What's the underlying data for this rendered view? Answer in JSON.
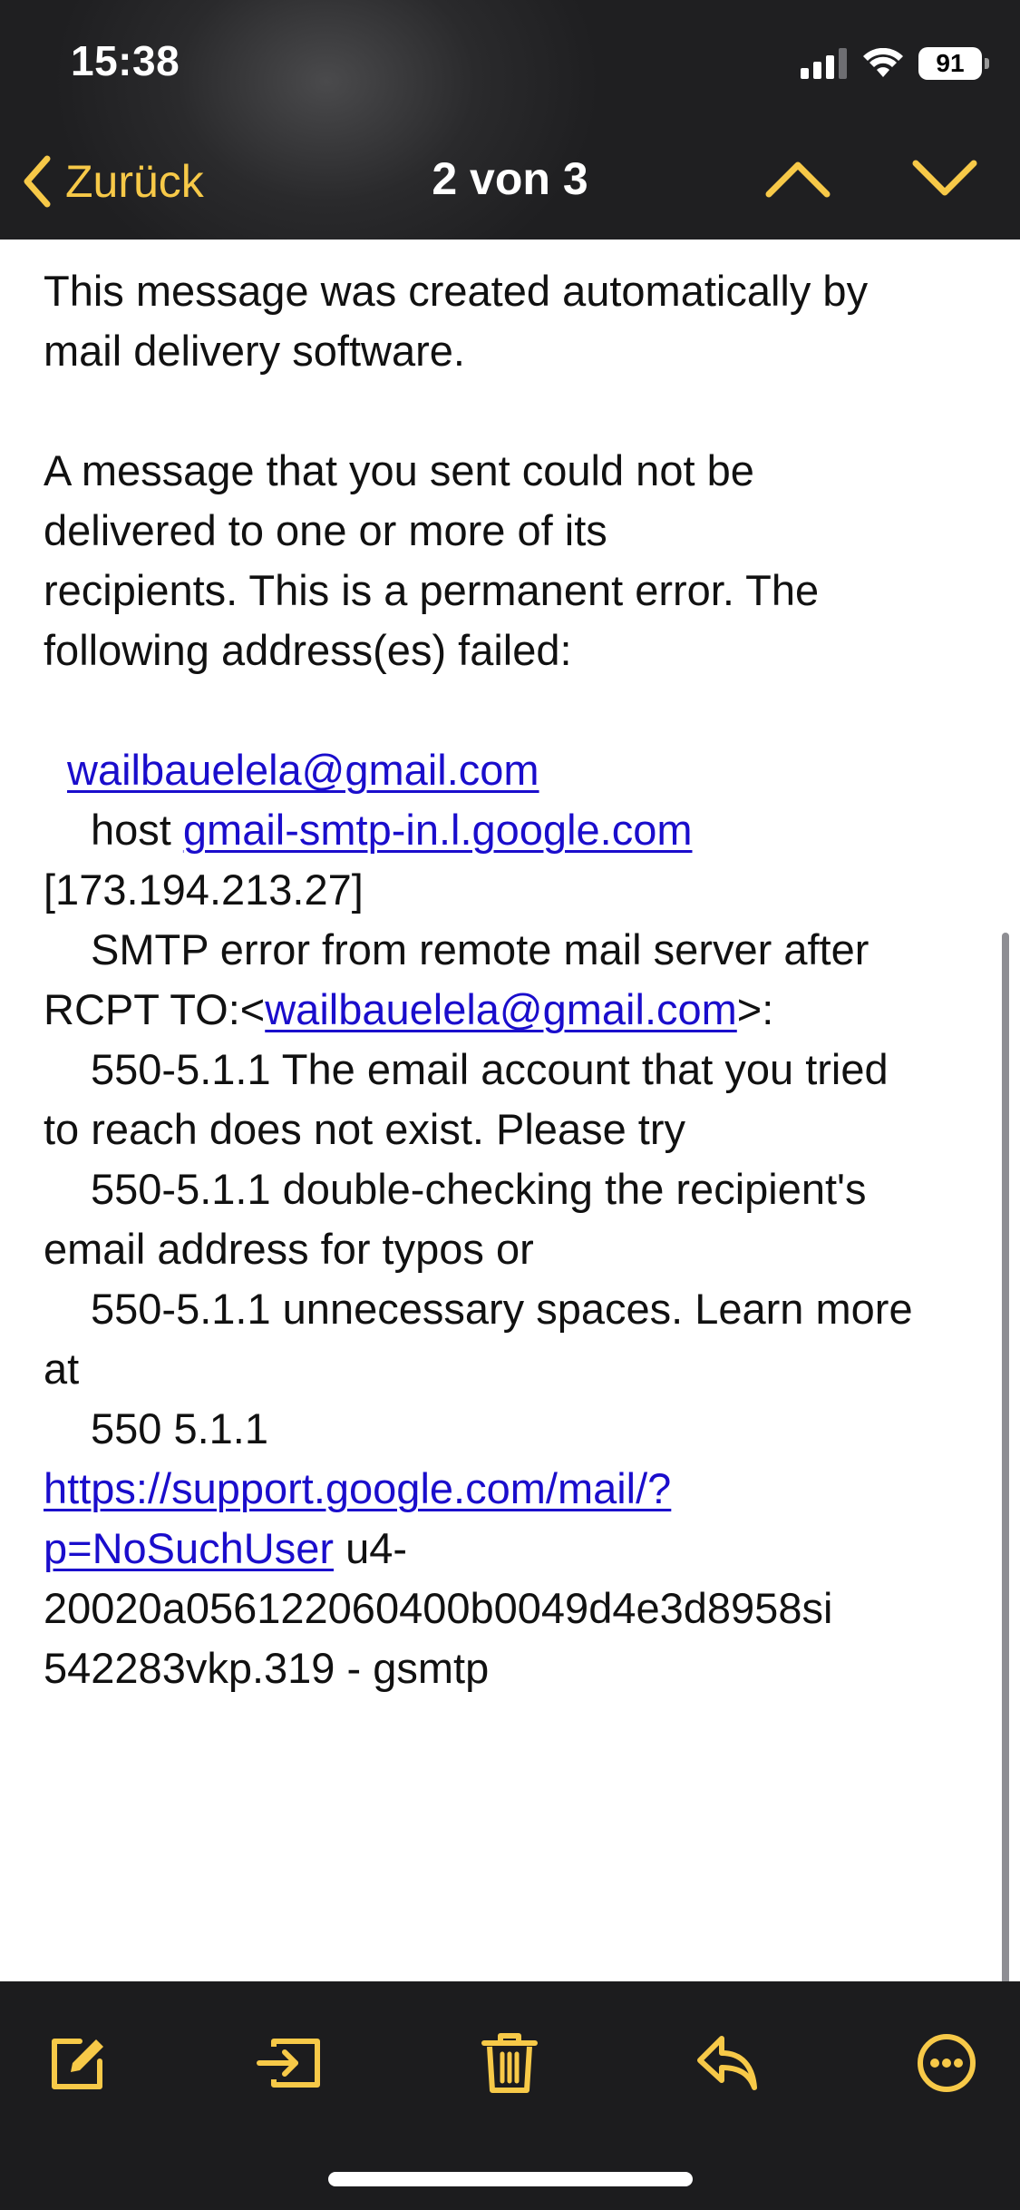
{
  "status_bar": {
    "time": "15:38",
    "battery": "91"
  },
  "nav": {
    "back_label": "Zurück",
    "title": "2 von 3"
  },
  "message": {
    "p1_l1": "This message was created automatically by",
    "p1_l2": "mail delivery software.",
    "p2_l1": "A message that you sent could not be",
    "p2_l2": "delivered to one or more of its",
    "p2_l3": "recipients. This is a permanent error. The",
    "p2_l4": "following address(es) failed:",
    "recipient_email": "wailbauelela@gmail.com",
    "host_prefix": "host ",
    "host_link": "gmail-smtp-in.l.google.com",
    "host_ip": "[173.194.213.27]",
    "smtp_error": "SMTP error from remote mail server after",
    "rcpt_prefix": "RCPT TO:<",
    "rcpt_email": "wailbauelela@gmail.com",
    "rcpt_suffix": ">:",
    "err1_l1": "550-5.1.1 The email account that you tried",
    "err1_l2": "to reach does not exist. Please try",
    "err2_l1": "550-5.1.1 double-checking the recipient's",
    "err2_l2": "email address for typos or",
    "err3_l1": "550-5.1.1 unnecessary spaces. Learn more",
    "err3_l2": "at",
    "err4": "550 5.1.1",
    "support_link_l1": "https://support.google.com/mail/?",
    "support_link_l2": "p=NoSuchUser",
    "trace_l1_suffix": " u4-",
    "trace_l2": "20020a056122060400b0049d4e3d8958si",
    "trace_l3": "542283vkp.319 - gsmtp"
  },
  "colors": {
    "accent": "#f7c948",
    "link": "#1a0dcc",
    "bar_background": "#1c1c1e"
  },
  "toolbar": {
    "icons": [
      "compose-icon",
      "move-to-folder-icon",
      "trash-icon",
      "reply-icon",
      "more-icon"
    ]
  }
}
